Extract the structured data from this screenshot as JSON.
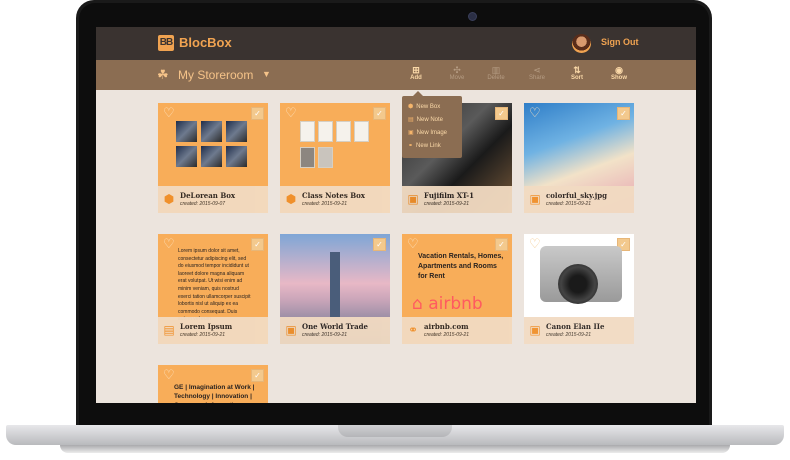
{
  "app": {
    "name": "BlocBox",
    "logo_text": "BB"
  },
  "header": {
    "signout_label": "Sign Out"
  },
  "storeroom": {
    "title": "My Storeroom"
  },
  "toolbar": {
    "add": "Add",
    "move": "Move",
    "delete": "Delete",
    "share": "Share",
    "sort": "Sort",
    "show": "Show"
  },
  "add_menu": {
    "items": [
      "New Box",
      "New Note",
      "New Image",
      "New Link"
    ]
  },
  "cards": [
    {
      "title": "DeLorean Box",
      "date": "created: 2015-09-07",
      "type": "box"
    },
    {
      "title": "Class Notes Box",
      "date": "created: 2015-09-21",
      "type": "box"
    },
    {
      "title": "Fujifilm XT-1",
      "date": "created: 2015-09-21",
      "type": "image"
    },
    {
      "title": "colorful_sky.jpg",
      "date": "created: 2015-09-21",
      "type": "image"
    },
    {
      "title": "Lorem Ipsum",
      "date": "created: 2015-09-21",
      "type": "note",
      "body": "Lorem ipsum dolor sit amet, consectetur adipiscing elit, sed do eiusmod tempor incididunt ut laoreet dolore magna aliquam erat volutpat. Ut wisi enim ad minim veniam, quis nostrud exerci tation ullamcorper suscipit lobortis nisl ut aliquip ex ea commodo consequat. Duis autem vel eum"
    },
    {
      "title": "One World Trade",
      "date": "created: 2015-09-21",
      "type": "image"
    },
    {
      "title": "airbnb.com",
      "date": "created: 2015-09-21",
      "type": "link",
      "body": "Vacation Rentals, Homes, Apartments and Rooms for Rent",
      "brand": "airbnb"
    },
    {
      "title": "Canon Elan IIe",
      "date": "created: 2015-09-21",
      "type": "image"
    },
    {
      "title": "",
      "date": "",
      "type": "link",
      "body": "GE | Imagination at Work | Technology | Innovation | Company Information"
    }
  ],
  "colors": {
    "accent": "#f8ad59",
    "topbar": "#3a3330",
    "toolbar": "#8b6d52",
    "background": "#ece4dd"
  }
}
